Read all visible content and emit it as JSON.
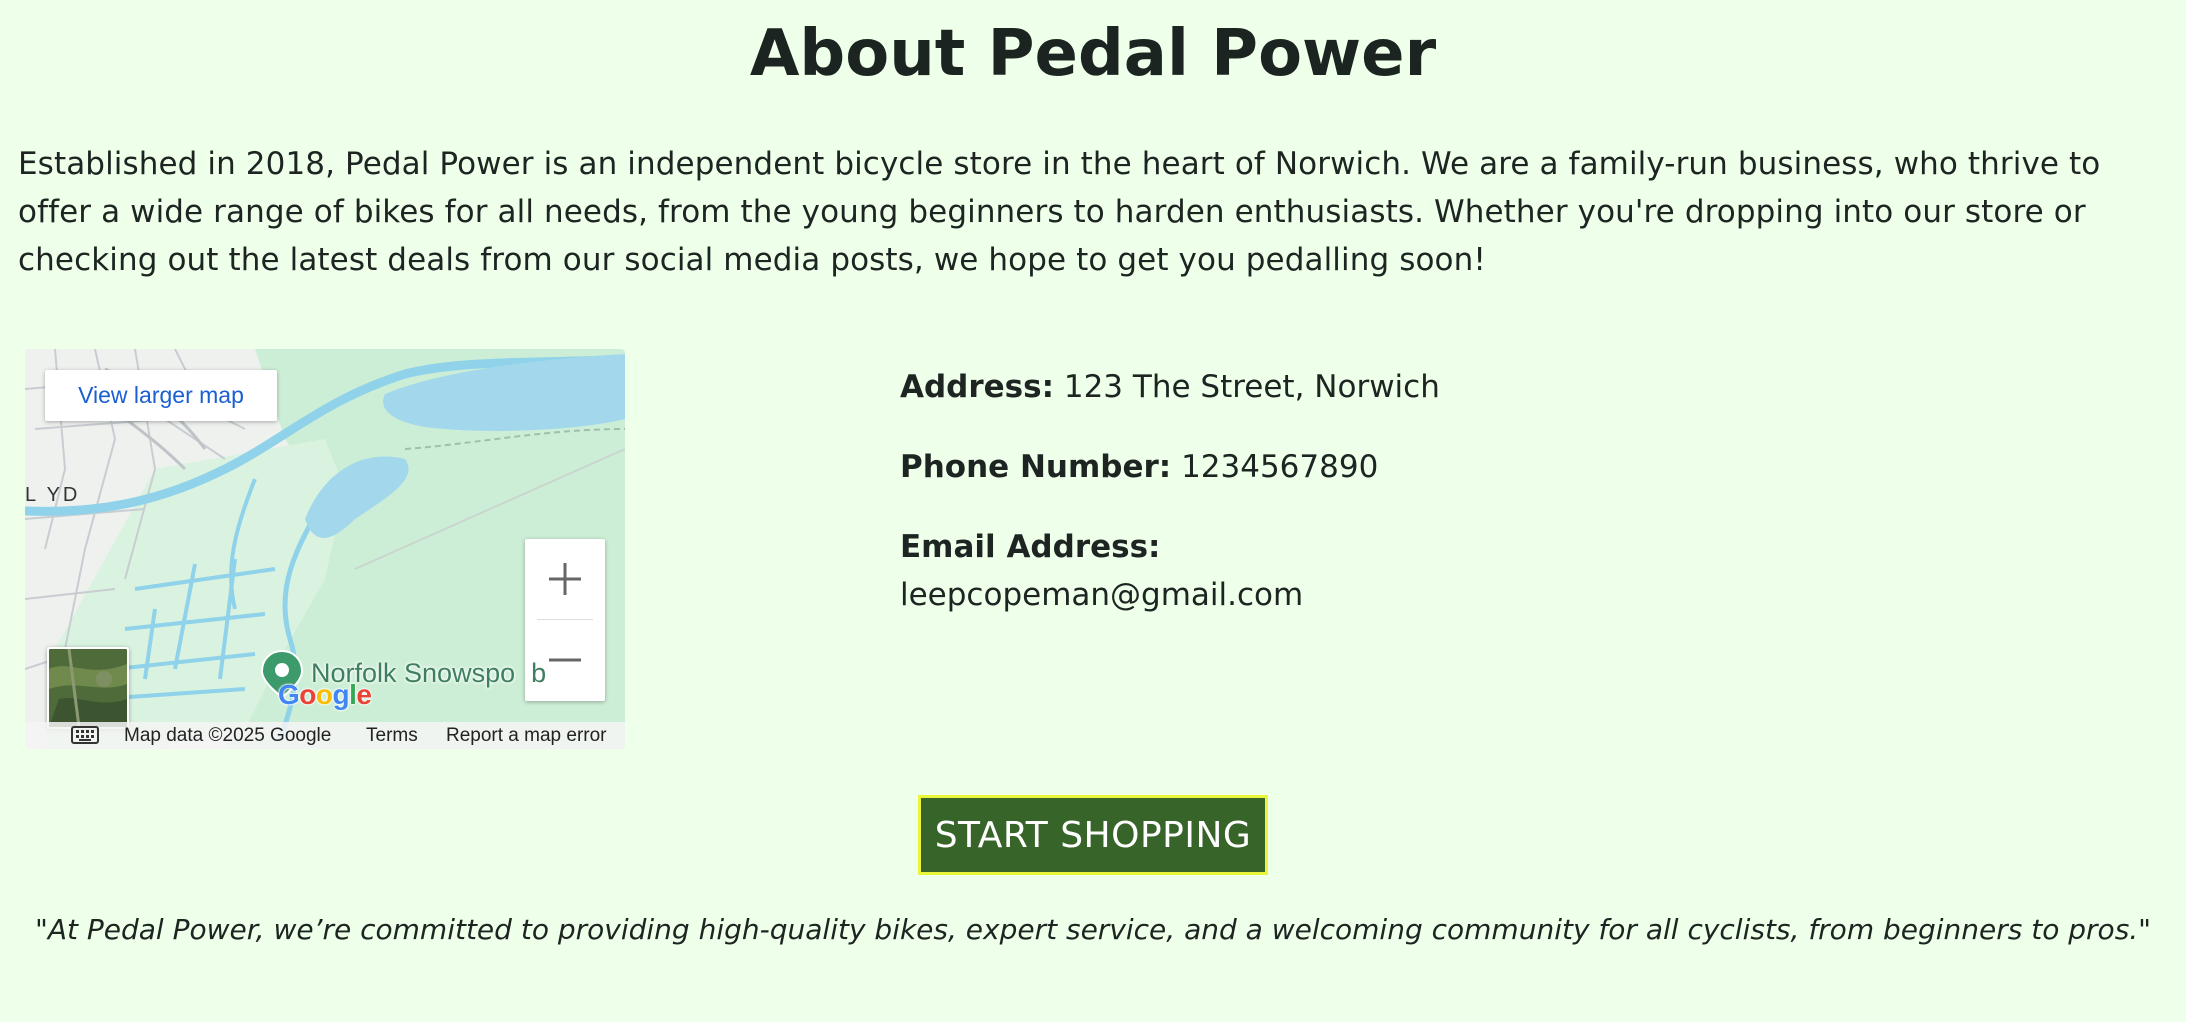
{
  "page": {
    "title": "About Pedal Power",
    "intro": "Established in 2018, Pedal Power is an independent bicycle store in the heart of Norwich. We are a family-run business, who thrive to offer a wide range of bikes for all needs, from the young beginners to harden enthusiasts. Whether you're dropping into our store or checking out the latest deals from our social media posts, we hope to get you pedalling soon!",
    "background_color": "#eeffea"
  },
  "map": {
    "larger_map_link": "View larger map",
    "area_label": "L YD",
    "place_label": "Norfolk Snowspo",
    "place_label_tail": "b",
    "logo": "Google",
    "attribution": {
      "map_data": "Map data ©2025 Google",
      "terms": "Terms",
      "report": "Report a map error"
    },
    "icons": {
      "zoom_in": "plus-icon",
      "zoom_out": "minus-icon",
      "keyboard": "keyboard-icon",
      "pin": "map-pin-icon"
    }
  },
  "contact": {
    "address_label": "Address:",
    "address_value": "123 The Street, Norwich",
    "phone_label": "Phone Number:",
    "phone_value": "1234567890",
    "email_label": "Email Address:",
    "email_value": "leepcopeman@gmail.com"
  },
  "cta": {
    "label": "START SHOPPING",
    "background": "#376428",
    "border": "#e8f53a"
  },
  "quote": "\"At Pedal Power, we’re committed to providing high-quality bikes, expert service, and a welcoming community for all cyclists, from beginners to pros.\""
}
